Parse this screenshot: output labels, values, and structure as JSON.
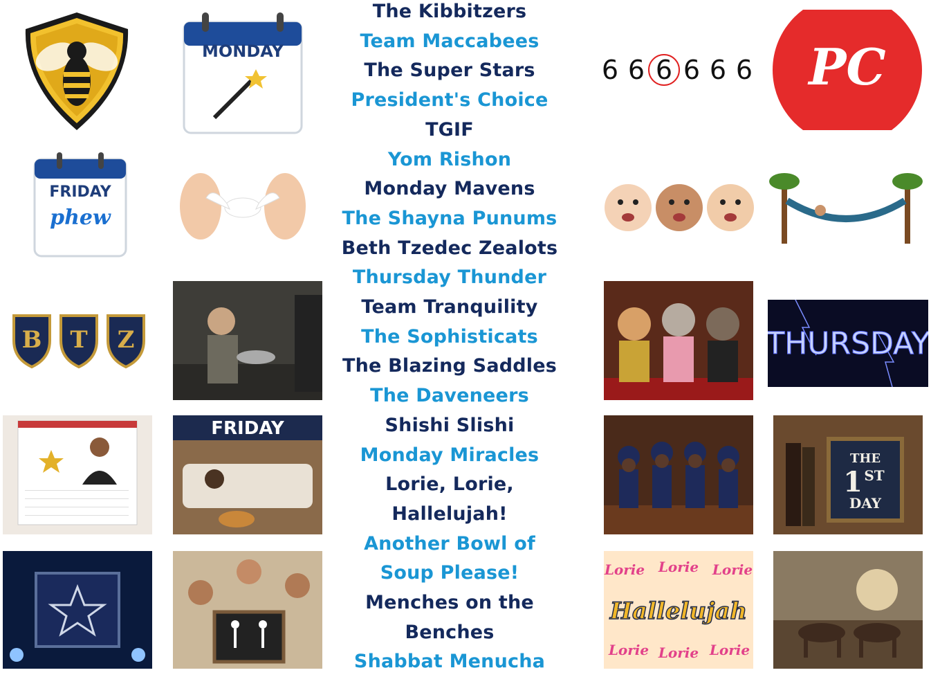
{
  "colors": {
    "navy": "#14295c",
    "sky": "#1a96d4"
  },
  "team_names": [
    "The Kibbitzers",
    "Team Maccabees",
    "The Super Stars",
    "President's Choice",
    "TGIF",
    "Yom Rishon",
    "Monday Mavens",
    "The Shayna Punums",
    "Beth Tzedec Zealots",
    "Thursday Thunder",
    "Team Tranquility",
    "The Sophisticats",
    "The Blazing Saddles",
    "The Daveneers",
    "Shishi Slishi",
    "Monday Miracles",
    "Lorie, Lorie,",
    "Hallelujah!",
    "Another Bowl of",
    "Soup Please!",
    "Menches on the",
    "Benches",
    "Shabbat Menucha"
  ],
  "name_colors": [
    "navy",
    "sky",
    "navy",
    "sky",
    "navy",
    "sky",
    "navy",
    "sky",
    "navy",
    "sky",
    "navy",
    "sky",
    "navy",
    "sky",
    "navy",
    "sky",
    "navy",
    "navy",
    "sky",
    "sky",
    "navy",
    "navy",
    "sky"
  ],
  "images": {
    "monday_calendar": {
      "text": "MONDAY",
      "icon": "magic-wand-icon"
    },
    "friday_calendar": {
      "line1": "FRIDAY",
      "line2": "phew"
    },
    "btz_shields": {
      "letters": [
        "B",
        "T",
        "Z"
      ]
    },
    "friday_sign": {
      "text": "FRIDAY"
    },
    "six_sequence": {
      "digits": [
        "6",
        "6",
        "6",
        "6",
        "6",
        "6"
      ],
      "circled_index": 2
    },
    "pc_logo": {
      "text": "PC"
    },
    "thursday_lightning": {
      "text": "THURSDAY"
    },
    "first_day_frame": {
      "line1": "THE",
      "line2": "1",
      "line3": "ST",
      "line4": "DAY"
    },
    "hallelujah_art": {
      "main": "Hallelujah",
      "word": "Lorie"
    }
  }
}
